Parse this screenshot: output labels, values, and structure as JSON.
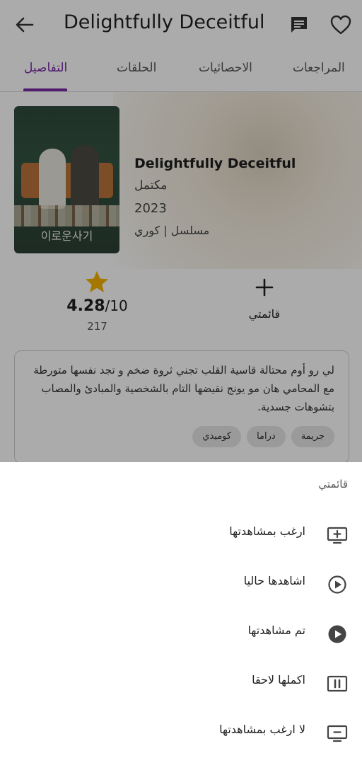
{
  "header": {
    "title": "Delightfully Deceitful",
    "icons": {
      "back": "arrow-back-icon",
      "comments": "chat-icon",
      "favorite": "heart-outline-icon"
    }
  },
  "tabs": [
    {
      "label": "المراجعات",
      "active": false
    },
    {
      "label": "الاحصائيات",
      "active": false
    },
    {
      "label": "الحلقات",
      "active": false
    },
    {
      "label": "التفاصيل",
      "active": true
    }
  ],
  "show": {
    "name": "Delightfully Deceitful",
    "status": "مكتمل",
    "year": "2023",
    "meta": "مسلسل | كوري",
    "poster_text": "이로운사기"
  },
  "rating": {
    "score": "4.28",
    "out_of": "/10",
    "votes": "217"
  },
  "my_list": {
    "label": "قائمتي"
  },
  "description": {
    "text": "لي رو أوم محتالة قاسية القلب تجني ثروة ضخم و تجد نفسها متورطة مع المحامي هان مو يونج نقيضها التام بالشخصية والمبادئ والمصاب بتشوهات جسدية.",
    "genres": [
      "جريمة",
      "دراما",
      "كوميدي"
    ]
  },
  "sheet": {
    "title": "قائمتي",
    "options": [
      {
        "label": "ارغب بمشاهدتها",
        "icon": "tv-plus-icon"
      },
      {
        "label": "اشاهدها حاليا",
        "icon": "play-circle-outline-icon"
      },
      {
        "label": "تم مشاهدتها",
        "icon": "play-circle-filled-icon"
      },
      {
        "label": "اكملها لاحقا",
        "icon": "pause-box-icon"
      },
      {
        "label": "لا ارغب بمشاهدتها",
        "icon": "tv-minus-icon"
      }
    ]
  },
  "colors": {
    "accent": "#7b2aa6",
    "star": "#f5b300",
    "scrim": "rgba(0,0,0,0.33)"
  }
}
